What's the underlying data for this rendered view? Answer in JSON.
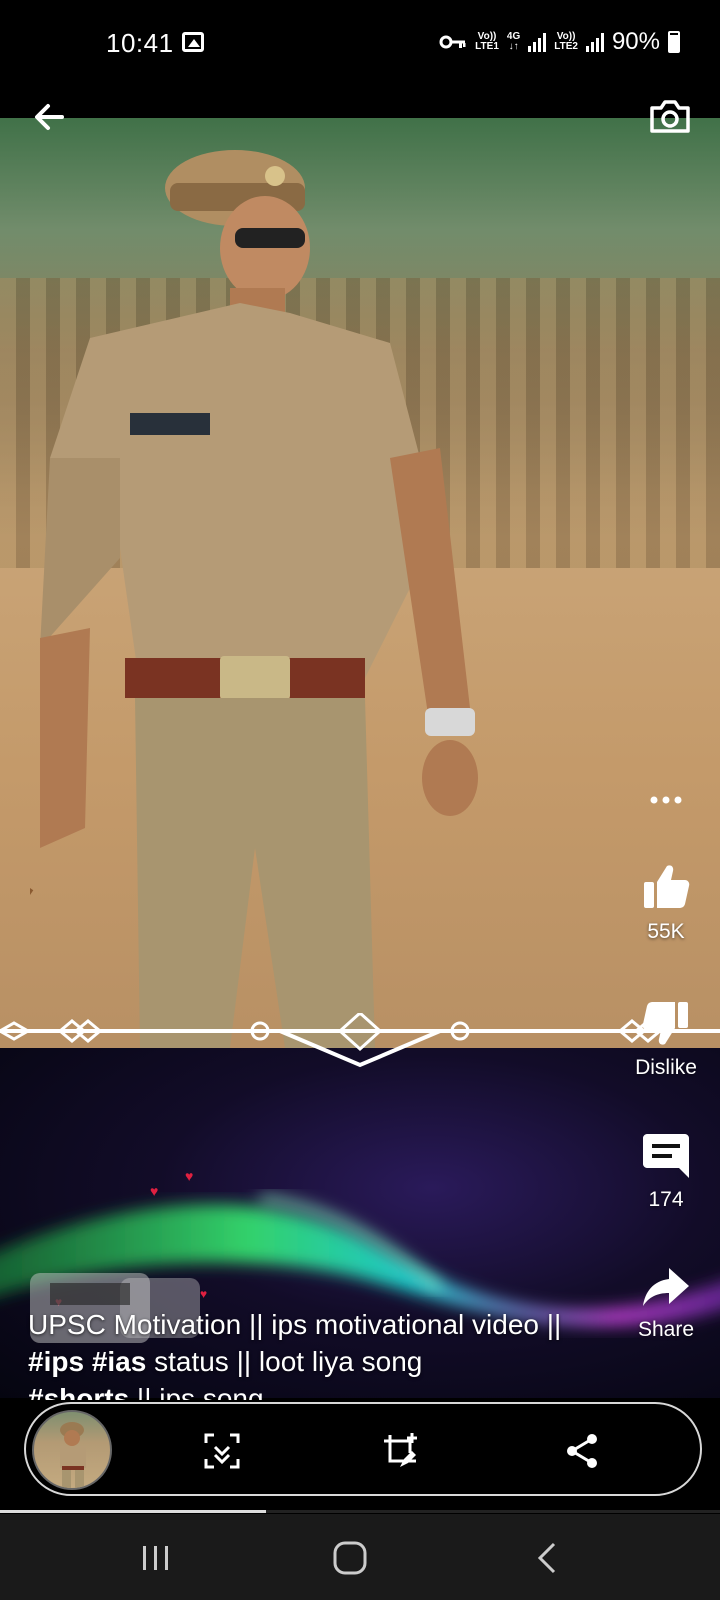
{
  "status_bar": {
    "time": "10:41",
    "sim1_label_top": "Vo))",
    "sim1_label_bottom": "LTE1",
    "net_label_top": "4G",
    "net_label_bottom": "↓↑",
    "sim2_label_top": "Vo))",
    "sim2_label_bottom": "LTE2",
    "battery_percent": "90%",
    "battery_level": 0.9
  },
  "top_controls": {
    "back_icon": "arrow-left-icon",
    "camera_icon": "camera-icon"
  },
  "actions": {
    "more_icon": "more-horizontal-icon",
    "like_icon": "thumbs-up-icon",
    "like_count": "55K",
    "dislike_icon": "thumbs-down-icon",
    "dislike_label": "Dislike",
    "comment_icon": "comment-icon",
    "comment_count": "174",
    "share_icon": "share-arrow-icon",
    "share_label": "Share"
  },
  "caption": {
    "part1": "UPSC Motivation || ips motivational video || ",
    "tag1": "#ips",
    "tag2": "#ias",
    "part2": " status || loot liya song ",
    "tag3": "#shorts",
    "part3": " || ips song"
  },
  "bottom_bar": {
    "thumbnail": "video-thumbnail",
    "buttons": [
      "fullscreen-scan-icon",
      "remix-edit-icon",
      "share-nodes-icon"
    ]
  },
  "progress": 0.37,
  "nav_bar": {
    "buttons": [
      "recent-apps-icon",
      "home-icon",
      "back-chevron-icon"
    ]
  },
  "colors": {
    "background": "#000000",
    "nav_bar": "#1a1a1a",
    "text": "#ffffff",
    "pill_border": "#d8d8d8"
  }
}
